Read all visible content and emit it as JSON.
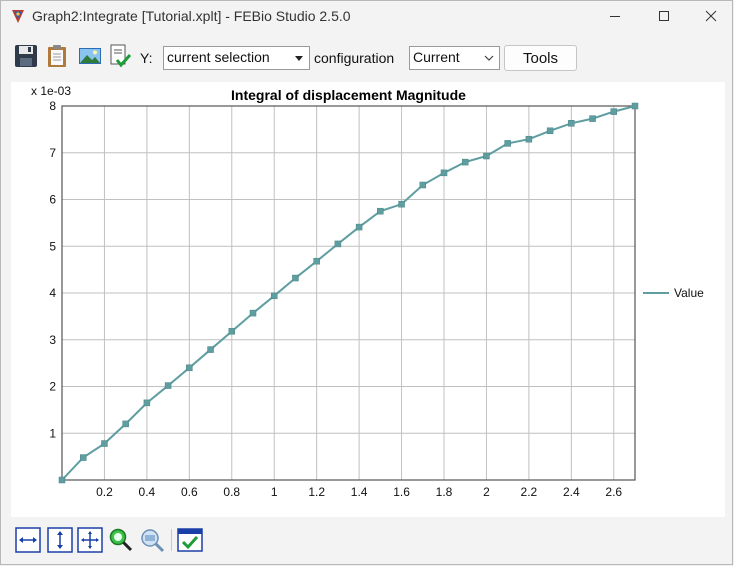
{
  "window": {
    "title": "Graph2:Integrate [Tutorial.xplt] - FEBio Studio 2.5.0"
  },
  "toolbar": {
    "icons": [
      "save-icon",
      "clipboard-icon",
      "image-icon",
      "document-check-icon"
    ],
    "y_label": "Y:",
    "y_select_value": "current selection",
    "config_label": "configuration",
    "config_select_value": "Current",
    "tools_label": "Tools"
  },
  "bottom_toolbar": {
    "icons": [
      "fit-width-icon",
      "fit-height-icon",
      "fit-all-icon",
      "zoom-icon",
      "zoom-reset-icon",
      "settings-check-icon"
    ]
  },
  "colors": {
    "series": "#5f9ea0",
    "grid": "#c0c0c0",
    "accent": "#1f6fd1"
  },
  "chart_data": {
    "type": "line",
    "title": "Integral of displacement Magnitude",
    "y_multiplier": "x 1e-03",
    "xlim": [
      0,
      2.7
    ],
    "ylim": [
      0,
      8
    ],
    "xticks": [
      "0.2",
      "0.4",
      "0.6",
      "0.8",
      "1",
      "1.2",
      "1.4",
      "1.6",
      "1.8",
      "2",
      "2.2",
      "2.4",
      "2.6"
    ],
    "yticks": [
      "1",
      "2",
      "3",
      "4",
      "5",
      "6",
      "7",
      "8"
    ],
    "grid": true,
    "legend_position": "right",
    "series": [
      {
        "name": "Value",
        "x": [
          0,
          0.1,
          0.2,
          0.3,
          0.4,
          0.5,
          0.6,
          0.7,
          0.8,
          0.9,
          1.0,
          1.1,
          1.2,
          1.3,
          1.4,
          1.5,
          1.6,
          1.7,
          1.8,
          1.9,
          2.0,
          2.1,
          2.2,
          2.3,
          2.4,
          2.5,
          2.6,
          2.7
        ],
        "y": [
          0,
          0.48,
          0.78,
          1.2,
          1.65,
          2.02,
          2.4,
          2.79,
          3.18,
          3.57,
          3.94,
          4.32,
          4.68,
          5.05,
          5.41,
          5.75,
          5.9,
          6.31,
          6.57,
          6.8,
          6.93,
          7.2,
          7.29,
          7.47,
          7.63,
          7.73,
          7.88,
          8.0
        ]
      }
    ]
  }
}
